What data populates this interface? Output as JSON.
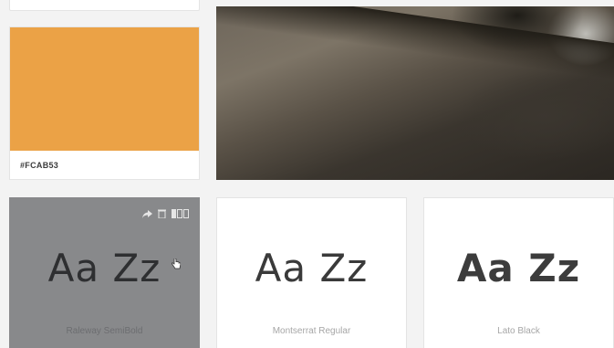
{
  "color_card": {
    "hex_label": "#FCAB53",
    "swatch_color": "#eba246"
  },
  "photo": {
    "icon": "mountain-photo"
  },
  "font_cards": [
    {
      "sample": "Aa Zz",
      "name": "Raleway SemiBold"
    },
    {
      "sample": "Aa Zz",
      "name": "Montserrat Regular"
    },
    {
      "sample": "Aa Zz",
      "name": "Lato Black"
    }
  ],
  "toolbar": {
    "share_icon": "share-icon",
    "delete_icon": "trash-icon",
    "layout_icon": "layout-icon"
  }
}
